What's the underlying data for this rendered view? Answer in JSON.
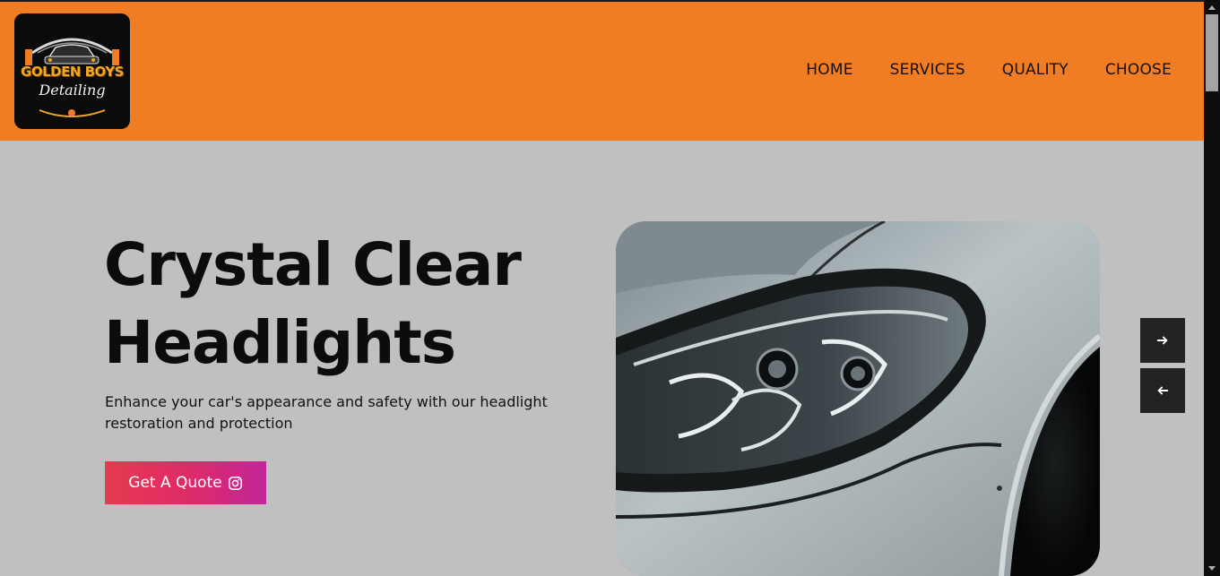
{
  "header": {
    "logo": {
      "line1": "GOLDEN BOYS",
      "line2": "Detailing"
    },
    "nav": [
      {
        "label": "HOME"
      },
      {
        "label": "SERVICES"
      },
      {
        "label": "QUALITY"
      },
      {
        "label": "CHOOSE"
      }
    ]
  },
  "hero": {
    "title_line1": "Crystal Clear",
    "title_line2": "Headlights",
    "subtitle": "Enhance your car's appearance and safety with our headlight restoration and protection",
    "cta_label": "Get A Quote",
    "cta_icon": "instagram-icon",
    "image_alt": "Close-up of a car headlight"
  },
  "slider": {
    "next_icon": "arrow-right-icon",
    "prev_icon": "arrow-left-icon"
  },
  "colors": {
    "header_bg": "#f07c23",
    "page_bg": "#c0c0c0",
    "logo_gold": "#f2a81d",
    "cta_start": "#e63a4e",
    "cta_end": "#c1269a",
    "slider_btn_bg": "#222222"
  }
}
